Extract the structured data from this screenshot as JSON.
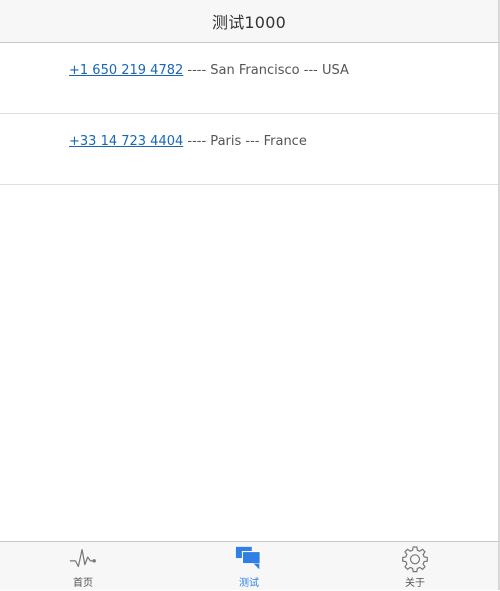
{
  "header": {
    "title": "测试1000"
  },
  "list": {
    "items": [
      {
        "phone": "+1 650 219 4782",
        "detail": " ---- San Francisco --- USA"
      },
      {
        "phone": "+33 14 723 4404",
        "detail": " ---- Paris --- France"
      }
    ]
  },
  "tabbar": {
    "tabs": [
      {
        "label": "首页",
        "icon": "pulse-icon",
        "active": false
      },
      {
        "label": "测试",
        "icon": "chat-bubbles-icon",
        "active": true
      },
      {
        "label": "关于",
        "icon": "gear-icon",
        "active": false
      }
    ]
  },
  "colors": {
    "accent": "#2f7fe6",
    "link": "#1a66b5",
    "bar_background": "#f7f7f7"
  }
}
